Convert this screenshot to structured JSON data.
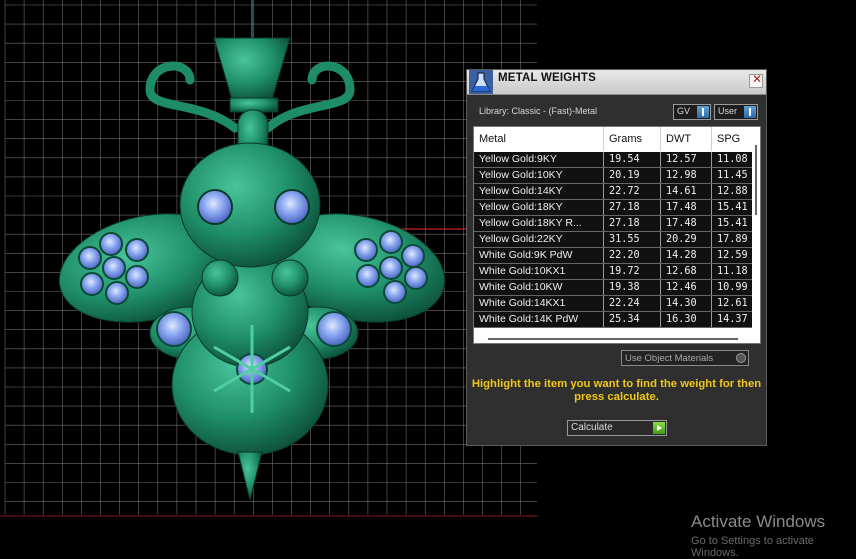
{
  "panel": {
    "title": "METAL WEIGHTS",
    "library_label": "Library: Classic - (Fast)-Metal",
    "toggle_gv": "GV",
    "toggle_user": "User",
    "columns": [
      "Metal",
      "Grams",
      "DWT",
      "SPG"
    ],
    "rows": [
      [
        "Yellow Gold:9KY",
        "19.54",
        "12.57",
        "11.08"
      ],
      [
        "Yellow Gold:10KY",
        "20.19",
        "12.98",
        "11.45"
      ],
      [
        "Yellow Gold:14KY",
        "22.72",
        "14.61",
        "12.88"
      ],
      [
        "Yellow Gold:18KY",
        "27.18",
        "17.48",
        "15.41"
      ],
      [
        "Yellow Gold:18KY R...",
        "27.18",
        "17.48",
        "15.41"
      ],
      [
        "Yellow Gold:22KY",
        "31.55",
        "20.29",
        "17.89"
      ],
      [
        "White Gold:9K PdW",
        "22.20",
        "14.28",
        "12.59"
      ],
      [
        "White Gold:10KX1",
        "19.72",
        "12.68",
        "11.18"
      ],
      [
        "White Gold:10KW",
        "19.38",
        "12.46",
        "10.99"
      ],
      [
        "White Gold:14KX1",
        "22.24",
        "14.30",
        "12.61"
      ],
      [
        "White Gold:14K PdW",
        "25.34",
        "16.30",
        "14.37"
      ]
    ],
    "use_object_materials": "Use Object Materials",
    "hint": "Highlight the item you want to find the weight for then press calculate.",
    "calculate": "Calculate"
  },
  "icons": {
    "title_icon": "flask-icon",
    "close": "close-icon",
    "calc_arrow": "play-arrow-icon"
  },
  "watermark": {
    "title": "Activate Windows",
    "subtitle": "Go to Settings to activate Windows."
  },
  "colors": {
    "model": "#1f8f6a",
    "gem": "#7f9ee8",
    "hint": "#f0c61c",
    "grid": "#6c6c6c"
  }
}
